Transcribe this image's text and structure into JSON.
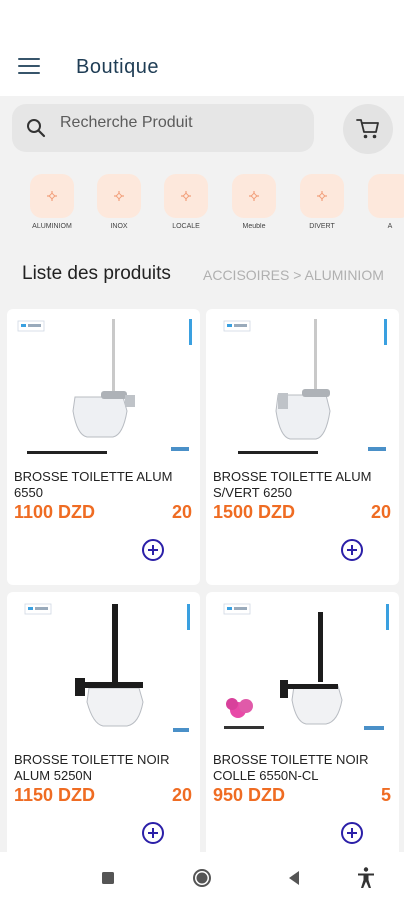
{
  "appbar": {
    "title": "Boutique"
  },
  "search": {
    "placeholder": "Recherche Produit"
  },
  "categories": [
    {
      "label": "ALUMINIOM"
    },
    {
      "label": "INOX"
    },
    {
      "label": "LOCALE"
    },
    {
      "label": "Meuble"
    },
    {
      "label": "DIVERT"
    },
    {
      "label": "A"
    }
  ],
  "list": {
    "title": "Liste des produits",
    "breadcrumb": "ACCISOIRES >  ALUMINIOM"
  },
  "products": [
    {
      "name": "BROSSE TOILETTE ALUM 6550",
      "price": "1100 DZD",
      "stock": "20"
    },
    {
      "name": "BROSSE TOILETTE ALUM S/VERT  6250",
      "price": "1500 DZD",
      "stock": "20"
    },
    {
      "name": "BROSSE TOILETTE NOIR ALUM 5250N",
      "price": "1150 DZD",
      "stock": "20"
    },
    {
      "name": "BROSSE TOILETTE NOIR COLLE 6550N-CL",
      "price": "950 DZD",
      "stock": "5"
    }
  ],
  "colors": {
    "accent": "#ef6c23",
    "title": "#1f3d55",
    "category_bg": "#fde8dc",
    "add_button": "#2b1fa8"
  },
  "icons": {
    "menu": "hamburger-icon",
    "search": "search-icon",
    "cart": "cart-icon",
    "add": "plus-circle-icon",
    "nav": [
      "square-icon",
      "circle-icon",
      "back-triangle-icon",
      "accessibility-icon"
    ]
  }
}
